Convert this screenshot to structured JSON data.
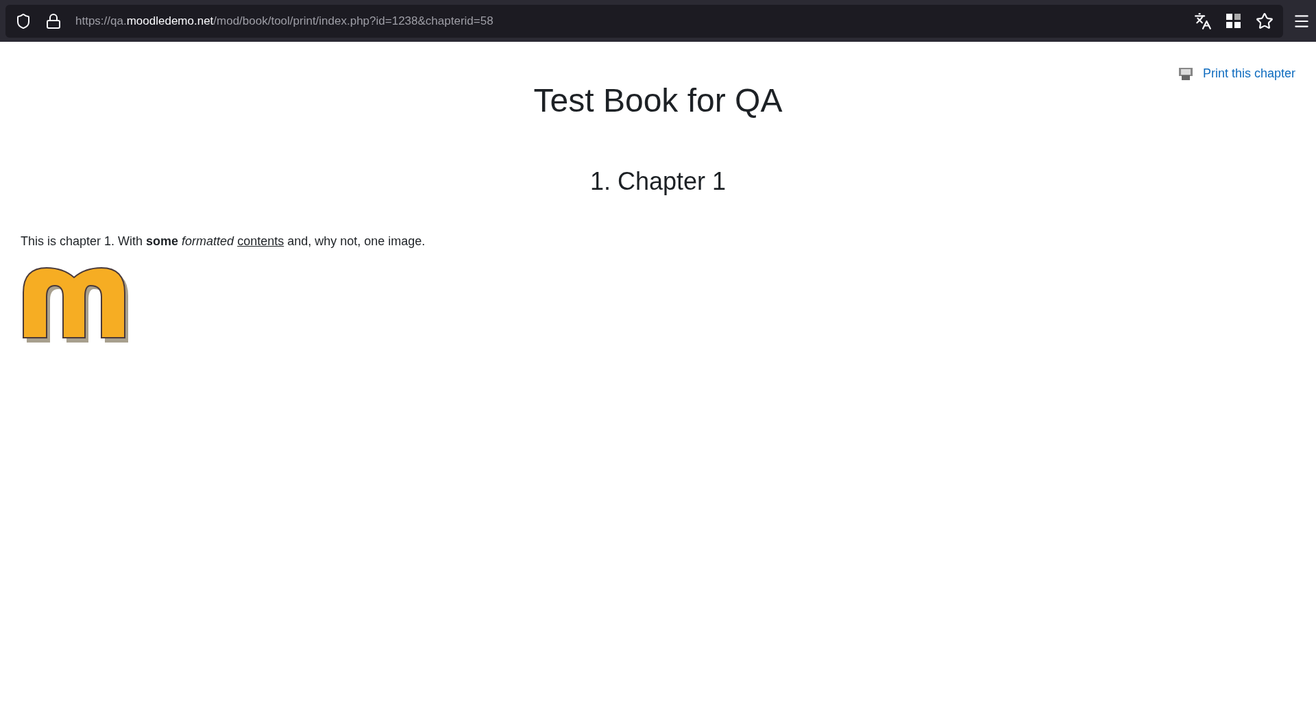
{
  "browser": {
    "url_scheme_host_prefix": "https://qa.",
    "url_domain": "moodledemo.net",
    "url_path": "/mod/book/tool/print/index.php?id=1238&chapterid=58"
  },
  "print_link": {
    "label": "Print this chapter"
  },
  "book_title": "Test Book for QA",
  "chapter_title": "1. Chapter 1",
  "paragraph": [
    {
      "kind": "plain",
      "text": "This is chapter 1. With "
    },
    {
      "kind": "bold",
      "text": "some"
    },
    {
      "kind": "italic",
      "text": " formatted "
    },
    {
      "kind": "underline",
      "text": "contents"
    },
    {
      "kind": "plain",
      "text": " and, why not, one image."
    }
  ]
}
